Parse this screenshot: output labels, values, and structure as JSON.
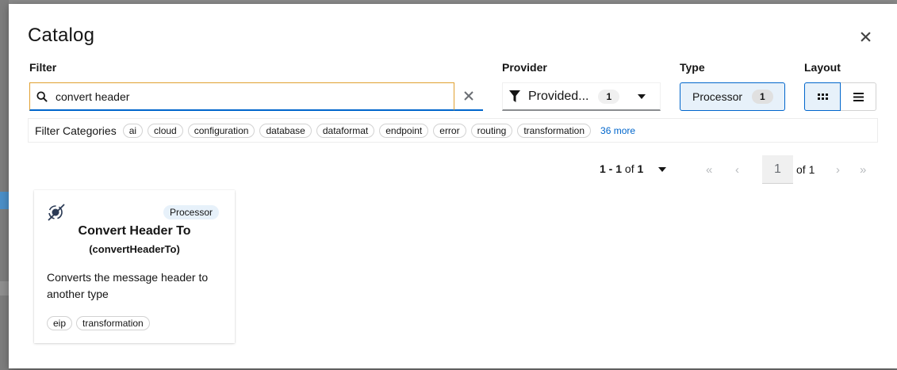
{
  "modal": {
    "title": "Catalog",
    "close_icon": "close-icon"
  },
  "filter": {
    "label": "Filter",
    "value": "convert header",
    "search_icon": "search-icon",
    "clear_icon": "clear-icon"
  },
  "provider": {
    "label": "Provider",
    "selected": "Provided...",
    "count": "1",
    "icon": "funnel-icon"
  },
  "type": {
    "label": "Type",
    "selected": "Processor",
    "count": "1"
  },
  "layout": {
    "label": "Layout",
    "options": [
      "grid-view-icon",
      "list-view-icon"
    ],
    "active": "grid"
  },
  "categories": {
    "title": "Filter Categories",
    "chips": [
      "ai",
      "cloud",
      "configuration",
      "database",
      "dataformat",
      "endpoint",
      "error",
      "routing",
      "transformation"
    ],
    "more": "36 more"
  },
  "pagination": {
    "range": "1 - 1",
    "of_total": "of",
    "total": "1",
    "page": "1",
    "of_pages": "of 1",
    "first": "«",
    "prev": "‹",
    "next": "›",
    "last": "»"
  },
  "cards": [
    {
      "badge": "Processor",
      "title": "Convert Header To",
      "subtitle": "(convertHeaderTo)",
      "description": "Converts the message header to another type",
      "tags": [
        "eip",
        "transformation"
      ]
    }
  ],
  "colors": {
    "accent": "#0066cc",
    "focus_border": "#e0a030",
    "selected_bg": "#e7f1fa"
  }
}
